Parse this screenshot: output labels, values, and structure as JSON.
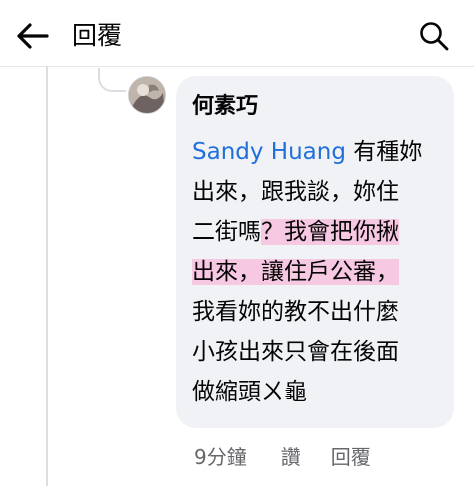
{
  "header": {
    "back_icon": "arrow-left-icon",
    "title": "回覆",
    "search_icon": "search-icon"
  },
  "comment": {
    "author": "何素巧",
    "mention": "Sandy Huang",
    "lines": [
      {
        "pre": " 有種妳",
        "hl": ""
      },
      {
        "pre": "出來，跟我談，妳住",
        "hl": ""
      },
      {
        "pre": "二街嗎",
        "hl": "？我會把你揪"
      },
      {
        "pre": "",
        "hl": "出來，讓住戶公審，"
      },
      {
        "pre": "我看妳的教不出什麼",
        "hl": ""
      },
      {
        "pre": "小孩出來只會在後面",
        "hl": ""
      },
      {
        "pre": "做縮頭ㄨ龜",
        "hl": ""
      }
    ]
  },
  "meta": {
    "time": "9分鐘",
    "like": "讚",
    "reply": "回覆"
  },
  "colors": {
    "mention": "#216fdb",
    "highlight": "#f7c8e2",
    "bubble": "#f0f2f5"
  }
}
